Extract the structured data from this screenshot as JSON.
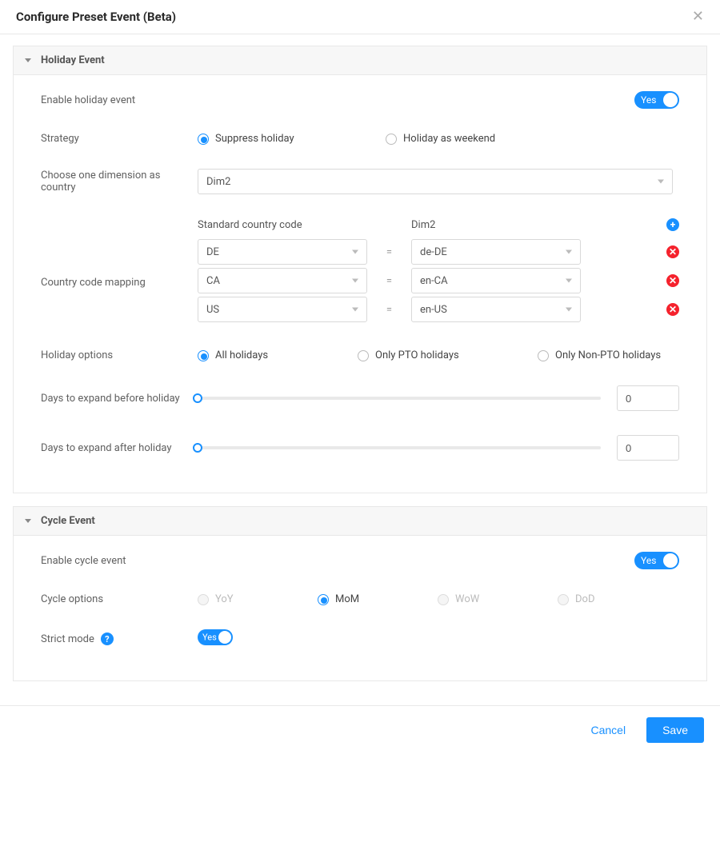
{
  "modal_title": "Configure Preset Event (Beta)",
  "toggle_on_label": "Yes",
  "sections": {
    "holiday": {
      "title": "Holiday Event",
      "enable_label": "Enable holiday event",
      "strategy_label": "Strategy",
      "strategy_options": {
        "suppress": "Suppress holiday",
        "weekend": "Holiday as weekend"
      },
      "dimension_label": "Choose one dimension as country",
      "dimension_value": "Dim2",
      "mapping_label": "Country code mapping",
      "mapping_header": {
        "left": "Standard country code",
        "right": "Dim2"
      },
      "mappings": [
        {
          "code": "DE",
          "value": "de-DE"
        },
        {
          "code": "CA",
          "value": "en-CA"
        },
        {
          "code": "US",
          "value": "en-US"
        }
      ],
      "holiday_options_label": "Holiday options",
      "holiday_options": {
        "all": "All holidays",
        "pto": "Only PTO holidays",
        "nonpto": "Only Non-PTO holidays"
      },
      "before_label": "Days to expand before holiday",
      "before_value": "0",
      "after_label": "Days to expand after holiday",
      "after_value": "0"
    },
    "cycle": {
      "title": "Cycle Event",
      "enable_label": "Enable cycle event",
      "options_label": "Cycle options",
      "options": {
        "yoy": "YoY",
        "mom": "MoM",
        "wow": "WoW",
        "dod": "DoD"
      },
      "strict_label": "Strict mode"
    }
  },
  "footer": {
    "cancel": "Cancel",
    "save": "Save"
  }
}
